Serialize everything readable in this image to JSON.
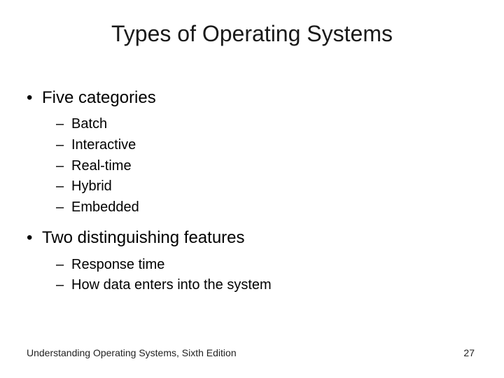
{
  "title": "Types of Operating Systems",
  "bullets": [
    {
      "text": "Five categories",
      "sub": [
        "Batch",
        "Interactive",
        "Real-time",
        "Hybrid",
        "Embedded"
      ]
    },
    {
      "text": "Two distinguishing features",
      "sub": [
        "Response time",
        "How data enters into the system"
      ]
    }
  ],
  "footer": {
    "book": "Understanding Operating Systems, Sixth Edition",
    "page": "27"
  }
}
